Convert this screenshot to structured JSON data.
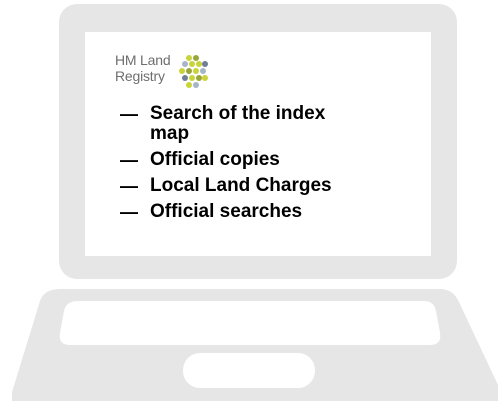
{
  "brand": {
    "line1": "HM Land",
    "line2": "Registry",
    "logo_icon": "hm-land-registry-logo",
    "logo_colors": [
      "#c8d43a",
      "#9aa63a",
      "#6f7f96",
      "#a7b5c8"
    ]
  },
  "services": [
    {
      "bullet": "—",
      "label": "Search of the index map"
    },
    {
      "bullet": "—",
      "label": "Official copies"
    },
    {
      "bullet": "—",
      "label": "Local Land Charges"
    },
    {
      "bullet": "—",
      "label": "Official searches"
    }
  ],
  "colors": {
    "device_frame": "#e5e5e5",
    "screen_bg": "#ffffff",
    "text": "#000000",
    "brand_text": "#6e6e6e"
  }
}
